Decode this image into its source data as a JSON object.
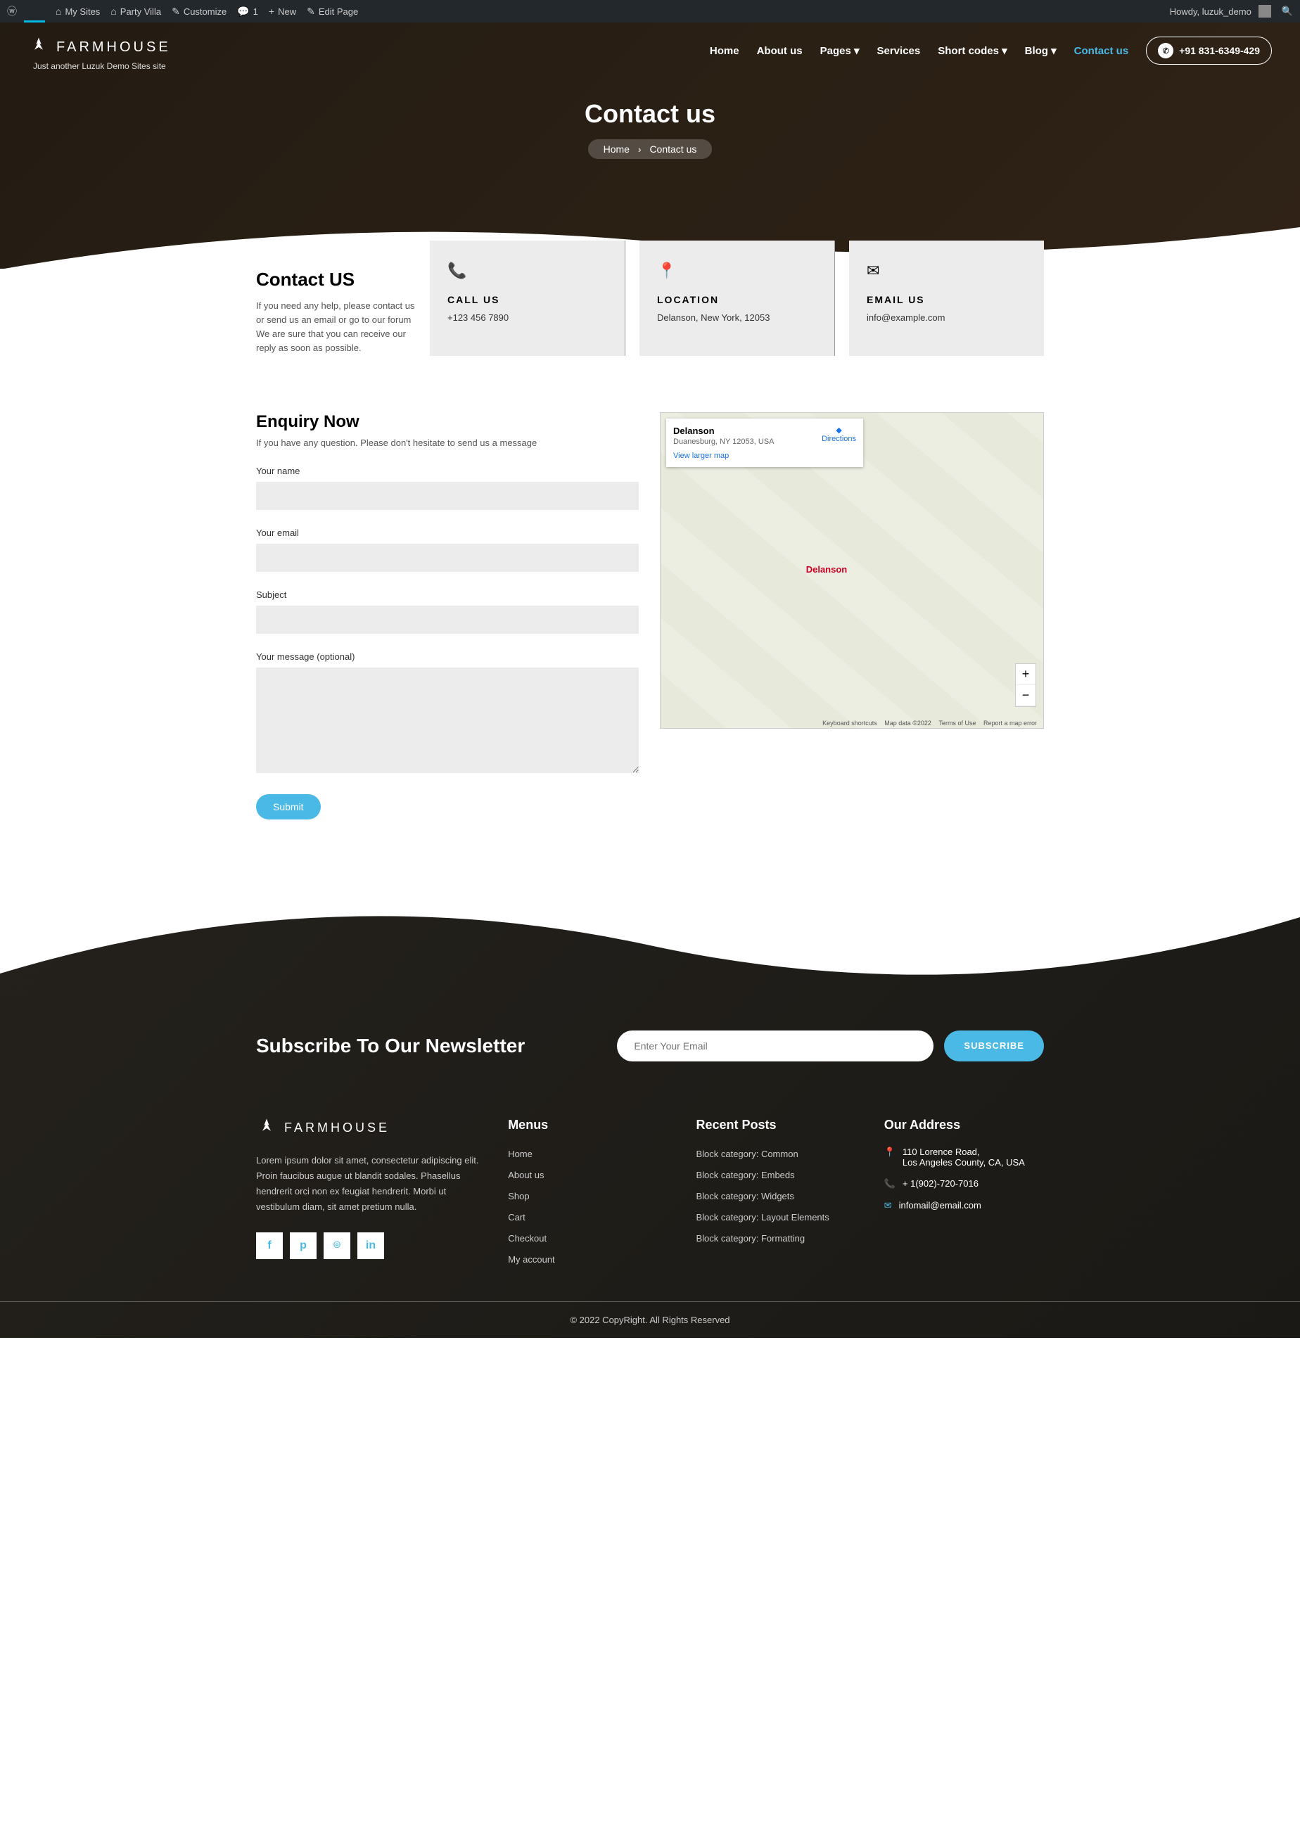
{
  "adminBar": {
    "mySites": "My Sites",
    "siteName": "Party Villa",
    "customize": "Customize",
    "comments": "1",
    "new": "New",
    "editPage": "Edit Page",
    "howdy": "Howdy, luzuk_demo"
  },
  "header": {
    "brand": "FARMHOUSE",
    "tagline": "Just another Luzuk Demo Sites site",
    "nav": {
      "home": "Home",
      "about": "About us",
      "pages": "Pages",
      "services": "Services",
      "shortcodes": "Short codes",
      "blog": "Blog",
      "contact": "Contact us"
    },
    "phone": "+91 831-6349-429"
  },
  "hero": {
    "title": "Contact us",
    "crumbHome": "Home",
    "crumbCurrent": "Contact us"
  },
  "contact": {
    "title": "Contact US",
    "intro": "If you need any help, please contact us or send us an email or go to our forum We are sure that you can receive our reply as soon as possible.",
    "call": {
      "label": "CALL US",
      "value": "+123 456 7890"
    },
    "location": {
      "label": "LOCATION",
      "value": "Delanson, New York, 12053"
    },
    "email": {
      "label": "EMAIL US",
      "value": "info@example.com"
    }
  },
  "enquiry": {
    "title": "Enquiry Now",
    "subtitle": "If you have any question. Please don't hesitate to send us a message",
    "labels": {
      "name": "Your name",
      "email": "Your email",
      "subject": "Subject",
      "message": "Your message (optional)"
    },
    "submit": "Submit"
  },
  "map": {
    "placeName": "Delanson",
    "placeAddr": "Duanesburg, NY 12053, USA",
    "viewLarger": "View larger map",
    "directions": "Directions",
    "townLabel": "Delanson",
    "credits": {
      "ks": "Keyboard shortcuts",
      "md": "Map data ©2022",
      "tou": "Terms of Use",
      "err": "Report a map error"
    }
  },
  "newsletter": {
    "title": "Subscribe To Our Newsletter",
    "placeholder": "Enter Your Email",
    "button": "SUBSCRIBE"
  },
  "footer": {
    "brand": "FARMHOUSE",
    "about": "Lorem ipsum dolor sit amet, consectetur adipiscing elit. Proin faucibus augue ut blandit sodales. Phasellus hendrerit orci non ex feugiat hendrerit. Morbi ut vestibulum diam, sit amet pretium nulla.",
    "menus": {
      "title": "Menus",
      "items": [
        "Home",
        "About us",
        "Shop",
        "Cart",
        "Checkout",
        "My account"
      ]
    },
    "recent": {
      "title": "Recent Posts",
      "items": [
        "Block category: Common",
        "Block category: Embeds",
        "Block category: Widgets",
        "Block category: Layout Elements",
        "Block category: Formatting"
      ]
    },
    "address": {
      "title": "Our Address",
      "line1": "110 Lorence Road,",
      "line2": "Los Angeles County, CA, USA",
      "phone": "+ 1(902)-720-7016",
      "email": "infomail@email.com"
    },
    "copyright": "© 2022 CopyRight. All Rights Reserved"
  }
}
